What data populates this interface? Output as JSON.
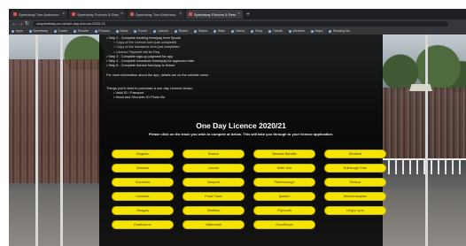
{
  "browser": {
    "tabs": [
      {
        "label": "Speedway Tom Anderson - Offic",
        "active": false
      },
      {
        "label": "Speedway Fixtures & Results",
        "active": false
      },
      {
        "label": "Speedway Tom Anderson - Offic",
        "active": false
      },
      {
        "label": "Speedway Fixtures & Results",
        "active": true
      }
    ],
    "new_tab": "+",
    "url": "ukspeedway.co.uk/one-day-licence-2020-21",
    "bookmarks": [
      "Apps",
      "Speedway",
      "Tracks",
      "Results",
      "Fixtures",
      "News",
      "Forum",
      "Licence",
      "Riders",
      "Teams",
      "Stats",
      "Videos",
      "Shop",
      "Tickets",
      "Weather",
      "Maps",
      "Reading list"
    ]
  },
  "steps": {
    "lines": [
      {
        "text": "• Step 2 - Complete booking form/pay from Sports",
        "sub": false
      },
      {
        "text": "○ Copy of the Licence form just completed",
        "sub": true
      },
      {
        "text": "○ Copy of the insurance form just completed",
        "sub": true
      },
      {
        "text": "○ Licence Payment will be Req",
        "sub": true
      },
      {
        "text": "• Step 3 - Complete sign-up payment for app",
        "sub": false
      },
      {
        "text": "• Step 4 - Complete insurance forms/pay for approved rider",
        "sub": false
      },
      {
        "text": "• Step 5 - Complete licence form/pay to fixture",
        "sub": false
      }
    ]
  },
  "info_text": "For more information about the app, details are on the website menu",
  "need": {
    "heading": "Things you'll need to purchase a one day Licence below:",
    "items": [
      "• Valid ID / Passport",
      "• Head and Shoulder ID Photo file"
    ]
  },
  "title": "One Day Licence 2020/21",
  "subtitle": "Please click on the track you wish to compete at below.  This will take you through to your licence application.",
  "tracks": [
    "Kingston",
    "Buxton",
    "Berwick Bandits",
    "Stratford",
    "Swindon",
    "Lincoln",
    "Belle Vue",
    "Edinburgh Park",
    "Somerset",
    "Newport",
    "Peterborough",
    "Redcar",
    "Leicester",
    "Poole Town",
    "Ipswich",
    "Wolverhampton",
    "Glasgow",
    "Sheffield",
    "Plymouth",
    "King's Lynn",
    "Eastbourne",
    "Mildenhall",
    "Scunthorpe"
  ],
  "footer_text": ""
}
